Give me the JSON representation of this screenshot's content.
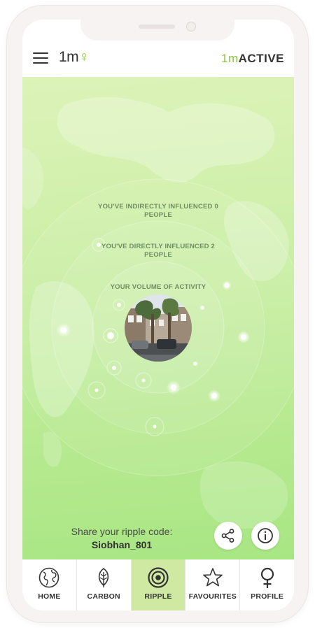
{
  "header": {
    "left_logo_main": "1m",
    "left_logo_mark": "♀",
    "right_logo_prefix": "1m",
    "right_logo_main": "ACTIVE"
  },
  "ripple": {
    "outer_label": "YOU'VE INDIRECTLY INFLUENCED 0 PEOPLE",
    "middle_label": "YOU'VE DIRECTLY INFLUENCED 2 PEOPLE",
    "inner_label": "YOUR VOLUME OF ACTIVITY"
  },
  "share": {
    "label": "Share your ripple code:",
    "code": "Siobhan_801"
  },
  "actions": {
    "share_icon": "share-icon",
    "info_icon": "info-icon"
  },
  "tabs": [
    {
      "label": "HOME",
      "icon": "globe-icon"
    },
    {
      "label": "CARBON",
      "icon": "leaf-icon"
    },
    {
      "label": "RIPPLE",
      "icon": "ripple-icon",
      "active": true
    },
    {
      "label": "FAVOURITES",
      "icon": "star-icon"
    },
    {
      "label": "PROFILE",
      "icon": "female-symbol-icon"
    }
  ],
  "colors": {
    "accent": "#8cc63e",
    "active_tab": "#cfe9a3",
    "background_green": "#c6eda0"
  }
}
